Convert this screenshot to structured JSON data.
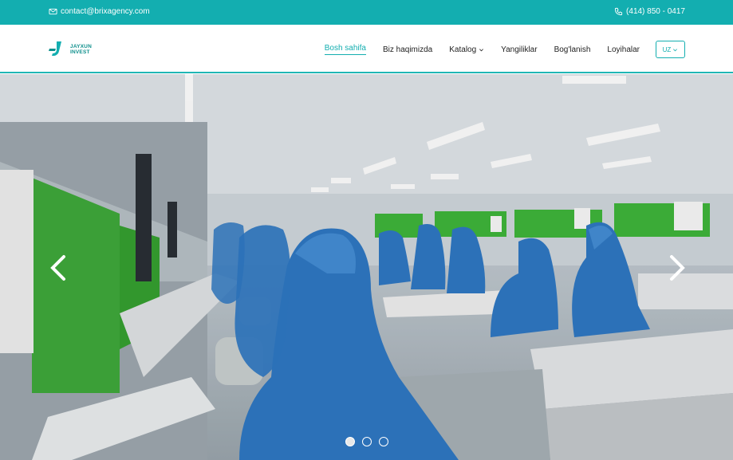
{
  "topbar": {
    "email": "contact@brixagency.com",
    "phone": "(414) 850 - 0417"
  },
  "logo": {
    "line1": "JAYXUN",
    "line2": "INVEST"
  },
  "nav": {
    "items": [
      {
        "label": "Bosh sahifa",
        "active": true
      },
      {
        "label": "Biz haqimizda"
      },
      {
        "label": "Katalog",
        "dropdown": true
      },
      {
        "label": "Yangiliklar"
      },
      {
        "label": "Bog'lanish"
      },
      {
        "label": "Loyihalar"
      }
    ],
    "lang": "UZ"
  },
  "colors": {
    "brand": "#13aeb0",
    "brand_dark": "#0e8f8c"
  },
  "hero": {
    "slides": 3,
    "active_slide": 1
  }
}
